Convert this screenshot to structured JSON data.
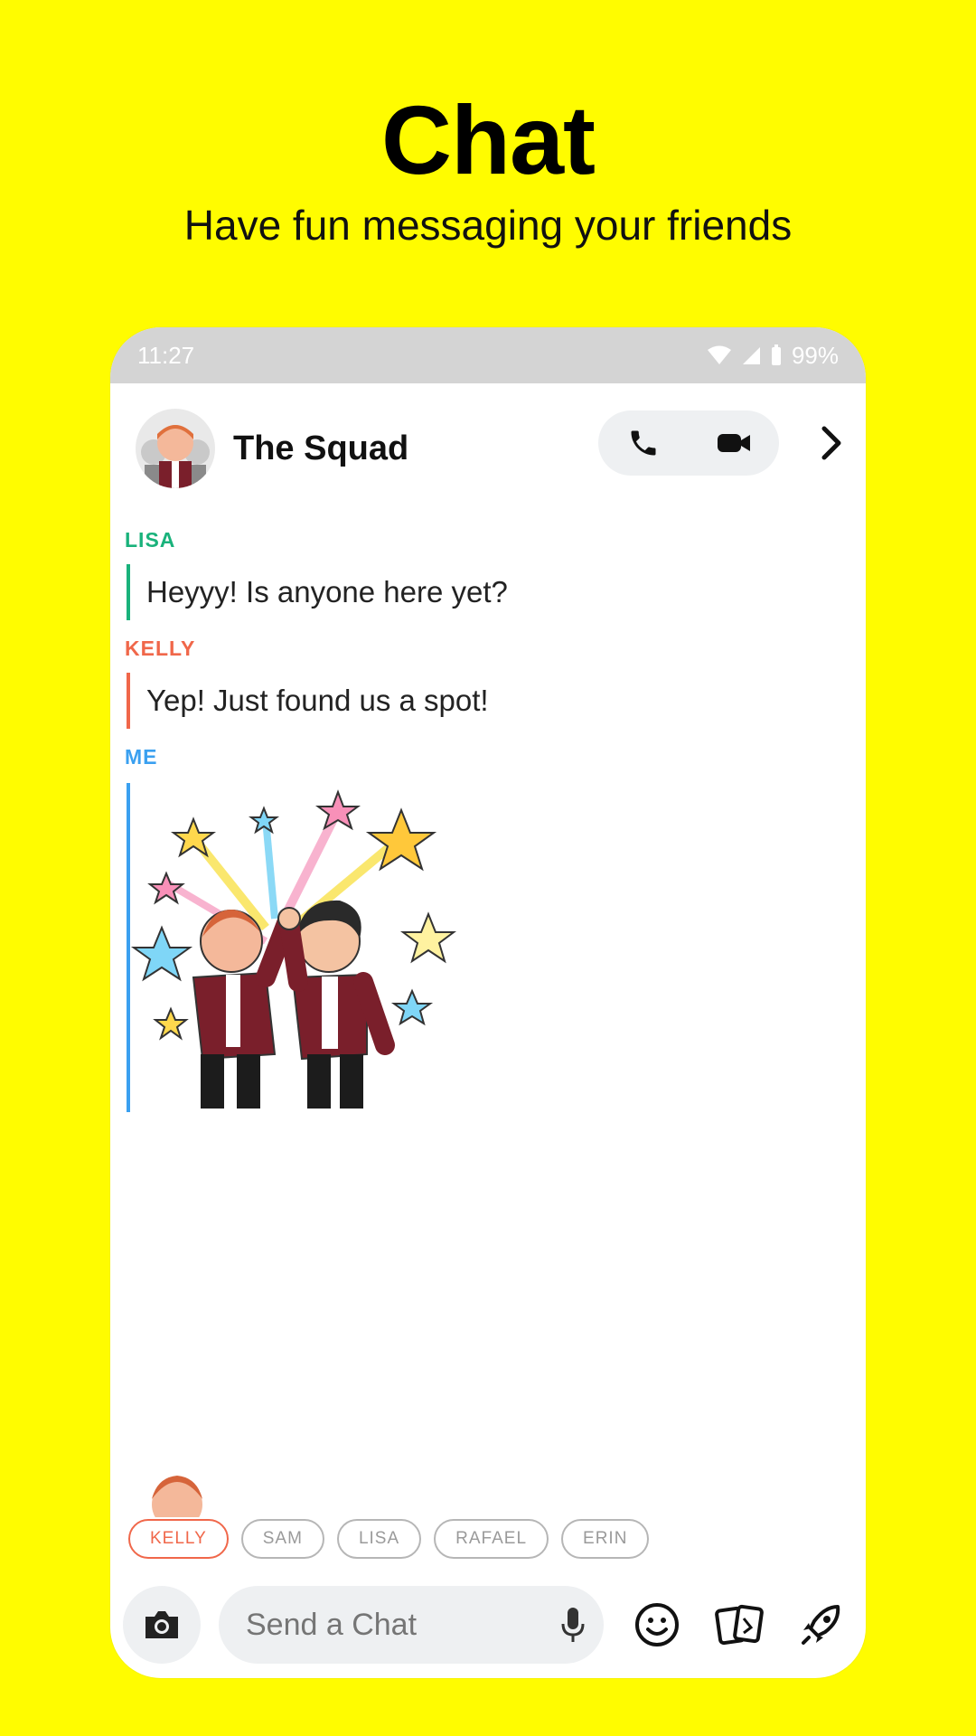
{
  "promo": {
    "headline": "Chat",
    "subhead": "Have fun messaging your friends"
  },
  "statusbar": {
    "time": "11:27",
    "battery": "99%"
  },
  "chat": {
    "title": "The Squad",
    "messages": [
      {
        "sender": "LISA",
        "text": "Heyyy! Is anyone here yet?",
        "color": "#19b27b"
      },
      {
        "sender": "KELLY",
        "text": "Yep! Just found us a spot!",
        "color": "#f0674a"
      },
      {
        "sender": "ME",
        "type": "sticker",
        "color": "#3aa0f0"
      }
    ]
  },
  "mentions": {
    "chips": [
      "KELLY",
      "SAM",
      "LISA",
      "RAFAEL",
      "ERIN"
    ],
    "active": "KELLY"
  },
  "composer": {
    "placeholder": "Send a Chat"
  },
  "colors": {
    "background": "#FFFC00",
    "lisa": "#19b27b",
    "kelly": "#f0674a",
    "me": "#3aa0f0"
  }
}
